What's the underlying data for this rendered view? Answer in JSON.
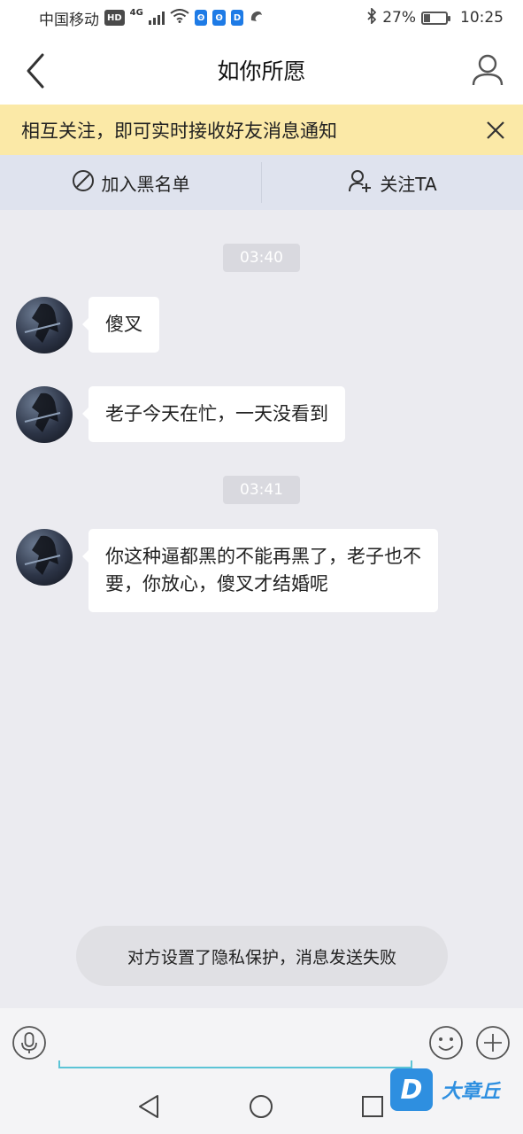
{
  "status_bar": {
    "carrier": "中国移动",
    "hd_badge": "HD",
    "network_type": "4G",
    "battery_percent": "27%",
    "time": "10:25"
  },
  "header": {
    "title": "如你所愿",
    "back_icon": "chevron-left-icon",
    "profile_icon": "person-icon"
  },
  "notice": {
    "text": "相互关注，即可实时接收好友消息通知",
    "close_icon": "close-icon"
  },
  "actions": {
    "block_label": "加入黑名单",
    "follow_label": "关注TA"
  },
  "chat": {
    "timestamps": [
      "03:40",
      "03:41"
    ],
    "messages": [
      {
        "text": "傻叉"
      },
      {
        "text": "老子今天在忙，一天没看到"
      },
      {
        "text": "你这种逼都黑的不能再黑了，老子也不要，你放心，傻叉才结婚呢"
      }
    ]
  },
  "toast": {
    "text": "对方设置了隐私保护，消息发送失败"
  },
  "input_bar": {
    "value": "",
    "placeholder": ""
  },
  "watermark": {
    "logo_letter": "D",
    "text": "大章丘"
  },
  "colors": {
    "notice_bg": "#fbe9a7",
    "action_bar_bg": "#dfe3ee",
    "chat_bg": "#ebebf0",
    "input_underline": "#5cc4d6",
    "watermark_blue": "#2e8fe0"
  }
}
